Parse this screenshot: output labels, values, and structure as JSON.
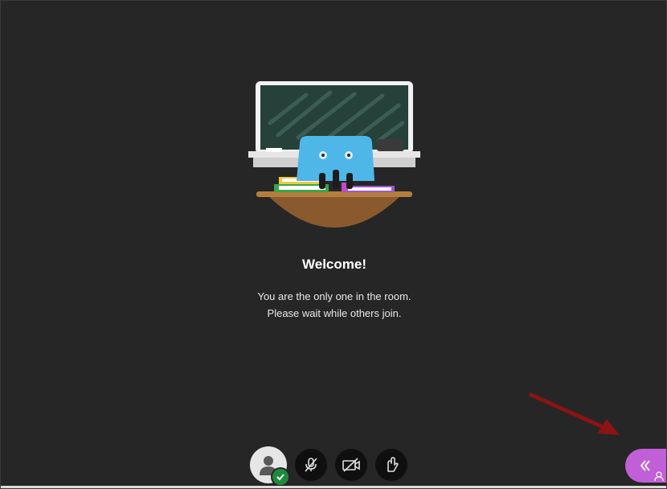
{
  "welcome": {
    "title": "Welcome!",
    "line1": "You are the only one in the room.",
    "line2": "Please wait while others join."
  },
  "controls": {
    "avatar_icon": "user-avatar-icon",
    "mic_icon": "microphone-muted-icon",
    "camera_icon": "camera-off-icon",
    "hand_icon": "raise-hand-icon"
  },
  "panel_tab": {
    "icon": "chevron-double-left-icon"
  },
  "colors": {
    "background": "#262626",
    "accent": "#c15fd8",
    "status_ok": "#1f8a3c",
    "arrow": "#8b1414"
  }
}
